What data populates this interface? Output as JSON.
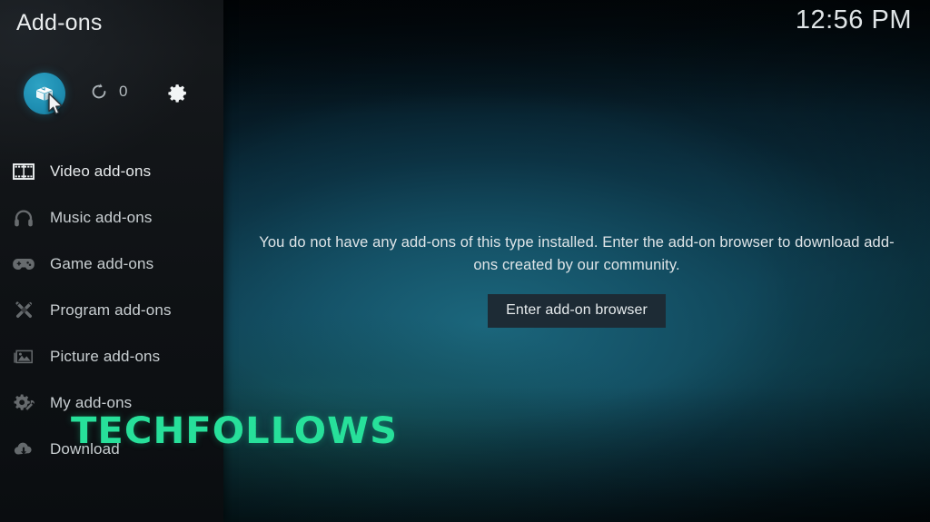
{
  "window": {
    "title": "Add-ons",
    "clock": "12:56 PM"
  },
  "toolbar": {
    "addons_button_name": "add-ons box",
    "refresh_label": "refresh",
    "update_count": "0",
    "settings_label": "settings"
  },
  "sidebar": {
    "items": [
      {
        "label": "Video add-ons",
        "icon": "film-strip-icon",
        "selected": true
      },
      {
        "label": "Music add-ons",
        "icon": "headphones-icon",
        "selected": false
      },
      {
        "label": "Game add-ons",
        "icon": "gamepad-icon",
        "selected": false
      },
      {
        "label": "Program add-ons",
        "icon": "tools-icon",
        "selected": false
      },
      {
        "label": "Picture add-ons",
        "icon": "photo-icon",
        "selected": false
      },
      {
        "label": "My add-ons",
        "icon": "gear-wrench-icon",
        "selected": false
      },
      {
        "label": "Download",
        "icon": "cloud-download-icon",
        "selected": false
      }
    ]
  },
  "main": {
    "empty_message": "You do not have any add-ons of this type installed. Enter the add-on browser to download add-ons created by our community.",
    "browser_button": "Enter add-on browser"
  },
  "watermark": {
    "text": "TECHFOLLOWS"
  },
  "colors": {
    "accent": "#1f8fb3",
    "watermark_green": "#27e09a",
    "button_bg": "#1d2b35",
    "sidebar_bg": "#121518"
  }
}
